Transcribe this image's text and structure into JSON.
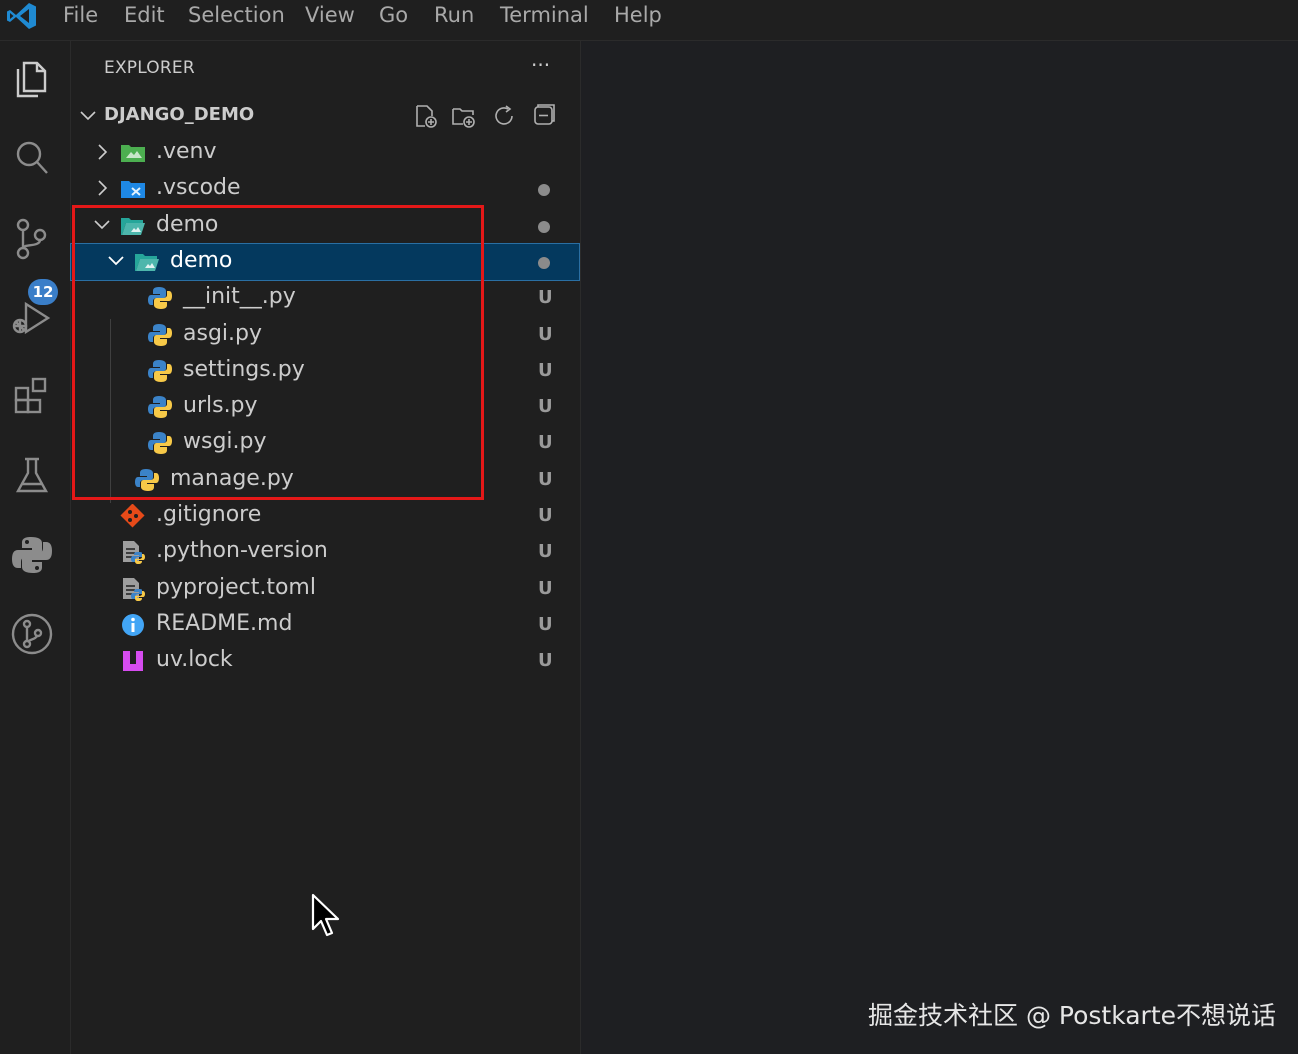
{
  "menu": {
    "logo_icon": "vscode-logo",
    "items": [
      "File",
      "Edit",
      "Selection",
      "View",
      "Go",
      "Run",
      "Terminal",
      "Help"
    ]
  },
  "activity_bar": {
    "icons": [
      "explorer-icon",
      "search-icon",
      "source-control-icon",
      "run-debug-icon",
      "extensions-icon",
      "testing-icon",
      "python-icon",
      "git-graph-icon"
    ],
    "source_control_badge": "12"
  },
  "explorer": {
    "title": "EXPLORER",
    "more_label": "···",
    "project": {
      "name": "DJANGO_DEMO",
      "actions": [
        "new-file-icon",
        "new-folder-icon",
        "refresh-icon",
        "collapse-all-icon"
      ]
    },
    "items": [
      {
        "label": ".venv",
        "kind": "folder",
        "status": ""
      },
      {
        "label": ".vscode",
        "kind": "folder",
        "status": "dot"
      },
      {
        "label": "demo",
        "kind": "folder-open",
        "status": "dot"
      },
      {
        "label": "demo",
        "kind": "folder-open",
        "status": "dot"
      },
      {
        "label": "__init__.py",
        "kind": "python",
        "status": "U"
      },
      {
        "label": "asgi.py",
        "kind": "python",
        "status": "U"
      },
      {
        "label": "settings.py",
        "kind": "python",
        "status": "U"
      },
      {
        "label": "urls.py",
        "kind": "python",
        "status": "U"
      },
      {
        "label": "wsgi.py",
        "kind": "python",
        "status": "U"
      },
      {
        "label": "manage.py",
        "kind": "python",
        "status": "U"
      },
      {
        "label": ".gitignore",
        "kind": "git",
        "status": "U"
      },
      {
        "label": ".python-version",
        "kind": "config",
        "status": "U"
      },
      {
        "label": "pyproject.toml",
        "kind": "config",
        "status": "U"
      },
      {
        "label": "README.md",
        "kind": "info",
        "status": "U"
      },
      {
        "label": "uv.lock",
        "kind": "lock",
        "status": "U"
      }
    ]
  },
  "colors": {
    "accent": "#3a7ec8",
    "highlight_box": "#e41818",
    "selected_row": "#04395e"
  },
  "watermark": "掘金技术社区 @ Postkarte不想说话"
}
